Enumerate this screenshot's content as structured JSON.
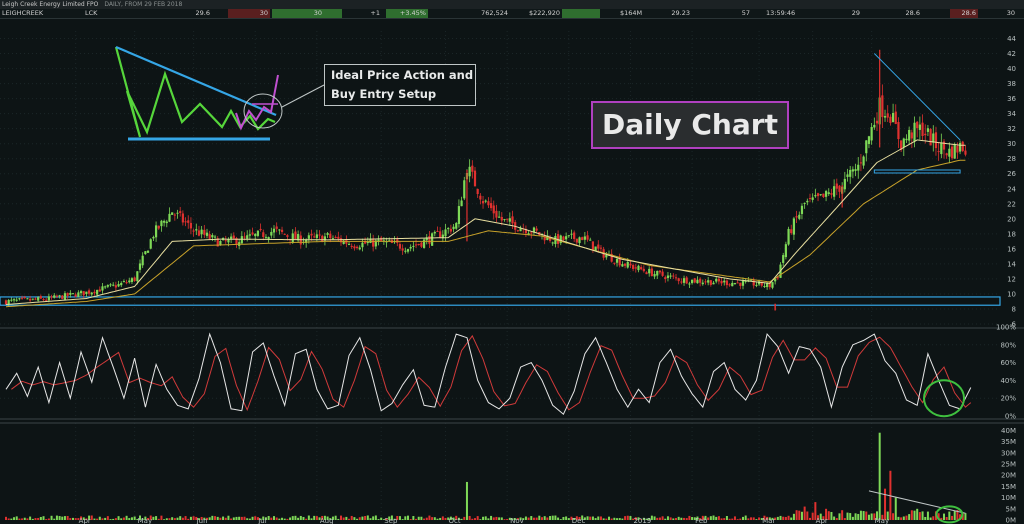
{
  "header": {
    "title": "Leigh Creek Energy Limited FPO",
    "subtitle": "DAILY, FROM 29 FEB 2018"
  },
  "quote": {
    "name": "LEIGHCREEK",
    "code": "LCK",
    "last": "29.6",
    "bid": "30",
    "ask": "30",
    "change": "+1",
    "change_pct": "+3.45%",
    "volume": "762,524",
    "value": "$222,920",
    "mcap": "$164M",
    "vwap": "29.23",
    "trades": "57",
    "time": "13:59:46",
    "open": "29",
    "high": "28.6",
    "low": "28.6",
    "close": "30"
  },
  "annotations": {
    "setup_line1": "Ideal Price Action and",
    "setup_line2": "Buy Entry Setup",
    "daily_label": "Daily Chart"
  },
  "colors": {
    "background": "#0d1415",
    "up_candle": "#7ed957",
    "down_candle": "#e0312f",
    "ema_fast": "#e8dfa0",
    "ema_slow": "#c8a22a",
    "trendline": "#35a6e6",
    "stoch_k": "#e6e6e6",
    "stoch_d": "#d03a3a",
    "highlight_circle": "#3fbf3f",
    "label_box_border": "#b040c0"
  },
  "chart_data": [
    {
      "type": "candlestick",
      "name": "price",
      "x_labels": [
        "Apr",
        "May",
        "Jun",
        "Jul",
        "Aug",
        "Sep",
        "Oct",
        "Nov",
        "Dec",
        "2019",
        "Feb",
        "Mar",
        "Apr",
        "May"
      ],
      "y_ticks": [
        6,
        8,
        10,
        12,
        14,
        16,
        18,
        20,
        22,
        24,
        26,
        28,
        30,
        32,
        34,
        36,
        38,
        40,
        42,
        44
      ],
      "ylim": [
        6,
        45
      ],
      "close_anchors": [
        [
          0,
          9
        ],
        [
          15,
          9.3
        ],
        [
          30,
          10.2
        ],
        [
          42,
          11.2
        ],
        [
          48,
          12
        ],
        [
          55,
          18
        ],
        [
          62,
          21
        ],
        [
          70,
          18.5
        ],
        [
          80,
          16.8
        ],
        [
          90,
          17.4
        ],
        [
          100,
          18.4
        ],
        [
          110,
          17.2
        ],
        [
          120,
          17.6
        ],
        [
          130,
          16.6
        ],
        [
          140,
          16.9
        ],
        [
          150,
          16.2
        ],
        [
          160,
          17.6
        ],
        [
          168,
          19.2
        ],
        [
          172,
          27
        ],
        [
          178,
          22.5
        ],
        [
          185,
          19.8
        ],
        [
          195,
          18.6
        ],
        [
          205,
          17.1
        ],
        [
          215,
          17.6
        ],
        [
          222,
          15.5
        ],
        [
          232,
          13.8
        ],
        [
          242,
          12.7
        ],
        [
          252,
          11.9
        ],
        [
          265,
          11.6
        ],
        [
          278,
          11.4
        ],
        [
          285,
          11.1
        ],
        [
          288,
          12.5
        ],
        [
          292,
          18
        ],
        [
          298,
          22
        ],
        [
          305,
          22.8
        ],
        [
          312,
          24.5
        ],
        [
          318,
          27
        ],
        [
          322,
          31
        ],
        [
          326,
          35
        ],
        [
          330,
          34
        ],
        [
          334,
          30
        ],
        [
          338,
          31.5
        ],
        [
          342,
          32
        ],
        [
          347,
          29.8
        ],
        [
          352,
          28.9
        ],
        [
          356,
          29.6
        ]
      ],
      "ema_fast_anchors": [
        [
          0,
          8.6
        ],
        [
          30,
          9.4
        ],
        [
          48,
          11
        ],
        [
          62,
          17
        ],
        [
          80,
          17.3
        ],
        [
          120,
          17.2
        ],
        [
          165,
          17.5
        ],
        [
          175,
          20
        ],
        [
          190,
          19
        ],
        [
          230,
          14.6
        ],
        [
          270,
          12
        ],
        [
          285,
          11.4
        ],
        [
          295,
          15.6
        ],
        [
          310,
          21.5
        ],
        [
          325,
          27.5
        ],
        [
          340,
          30.5
        ],
        [
          356,
          29.8
        ]
      ],
      "ema_slow_anchors": [
        [
          0,
          8.3
        ],
        [
          30,
          9
        ],
        [
          48,
          10
        ],
        [
          70,
          16.4
        ],
        [
          120,
          17
        ],
        [
          165,
          17
        ],
        [
          180,
          18.4
        ],
        [
          200,
          17.7
        ],
        [
          240,
          13.8
        ],
        [
          285,
          11.6
        ],
        [
          300,
          15.2
        ],
        [
          320,
          22
        ],
        [
          340,
          26.5
        ],
        [
          356,
          27.8
        ]
      ],
      "support_zone": [
        8.5,
        9.6
      ],
      "resistance_lines": [
        {
          "from": [
            324,
            42
          ],
          "to": [
            356,
            30.5
          ]
        }
      ],
      "support_lines": [
        {
          "from": [
            324,
            26.3
          ],
          "to": [
            356,
            26.3
          ]
        }
      ]
    },
    {
      "type": "line",
      "name": "stochastic",
      "y_ticks": [
        "0%",
        "20%",
        "40%",
        "60%",
        "80%",
        "100%"
      ],
      "ylim": [
        0,
        100
      ],
      "k_anchors": [
        [
          0,
          30
        ],
        [
          4,
          48
        ],
        [
          8,
          22
        ],
        [
          12,
          55
        ],
        [
          16,
          15
        ],
        [
          20,
          60
        ],
        [
          24,
          20
        ],
        [
          28,
          72
        ],
        [
          32,
          38
        ],
        [
          36,
          88
        ],
        [
          40,
          55
        ],
        [
          44,
          20
        ],
        [
          48,
          65
        ],
        [
          52,
          10
        ],
        [
          56,
          58
        ],
        [
          60,
          30
        ],
        [
          64,
          12
        ],
        [
          68,
          8
        ],
        [
          72,
          42
        ],
        [
          76,
          92
        ],
        [
          80,
          60
        ],
        [
          84,
          8
        ],
        [
          88,
          6
        ],
        [
          92,
          72
        ],
        [
          96,
          82
        ],
        [
          100,
          45
        ],
        [
          104,
          12
        ],
        [
          108,
          70
        ],
        [
          112,
          75
        ],
        [
          116,
          30
        ],
        [
          120,
          8
        ],
        [
          124,
          12
        ],
        [
          128,
          68
        ],
        [
          132,
          88
        ],
        [
          136,
          52
        ],
        [
          140,
          6
        ],
        [
          144,
          14
        ],
        [
          148,
          35
        ],
        [
          152,
          52
        ],
        [
          156,
          12
        ],
        [
          160,
          10
        ],
        [
          164,
          55
        ],
        [
          168,
          92
        ],
        [
          172,
          88
        ],
        [
          176,
          40
        ],
        [
          180,
          15
        ],
        [
          184,
          8
        ],
        [
          188,
          20
        ],
        [
          192,
          55
        ],
        [
          196,
          60
        ],
        [
          200,
          40
        ],
        [
          204,
          12
        ],
        [
          208,
          2
        ],
        [
          212,
          28
        ],
        [
          216,
          70
        ],
        [
          220,
          88
        ],
        [
          224,
          60
        ],
        [
          228,
          30
        ],
        [
          232,
          10
        ],
        [
          236,
          30
        ],
        [
          240,
          15
        ],
        [
          244,
          60
        ],
        [
          248,
          75
        ],
        [
          252,
          45
        ],
        [
          256,
          25
        ],
        [
          260,
          10
        ],
        [
          264,
          50
        ],
        [
          268,
          60
        ],
        [
          272,
          30
        ],
        [
          276,
          18
        ],
        [
          280,
          40
        ],
        [
          284,
          92
        ],
        [
          288,
          78
        ],
        [
          292,
          48
        ],
        [
          296,
          78
        ],
        [
          300,
          75
        ],
        [
          304,
          55
        ],
        [
          308,
          10
        ],
        [
          312,
          55
        ],
        [
          316,
          80
        ],
        [
          320,
          85
        ],
        [
          324,
          92
        ],
        [
          328,
          62
        ],
        [
          332,
          48
        ],
        [
          336,
          18
        ],
        [
          340,
          12
        ],
        [
          344,
          70
        ],
        [
          348,
          40
        ],
        [
          352,
          12
        ],
        [
          356,
          8
        ],
        [
          360,
          32
        ]
      ]
    },
    {
      "type": "bar",
      "name": "volume",
      "y_ticks": [
        "0M",
        "5M",
        "10M",
        "15M",
        "20M",
        "25M",
        "30M",
        "35M",
        "40M"
      ],
      "ylim": [
        0,
        42
      ],
      "spikes": [
        [
          172,
          17
        ],
        [
          298,
          6
        ],
        [
          302,
          8
        ],
        [
          306,
          5
        ],
        [
          320,
          4
        ],
        [
          326,
          39
        ],
        [
          328,
          14
        ],
        [
          330,
          22
        ],
        [
          332,
          10
        ],
        [
          340,
          5
        ],
        [
          348,
          3
        ],
        [
          354,
          4
        ]
      ],
      "baseline_level": 1.2
    }
  ]
}
